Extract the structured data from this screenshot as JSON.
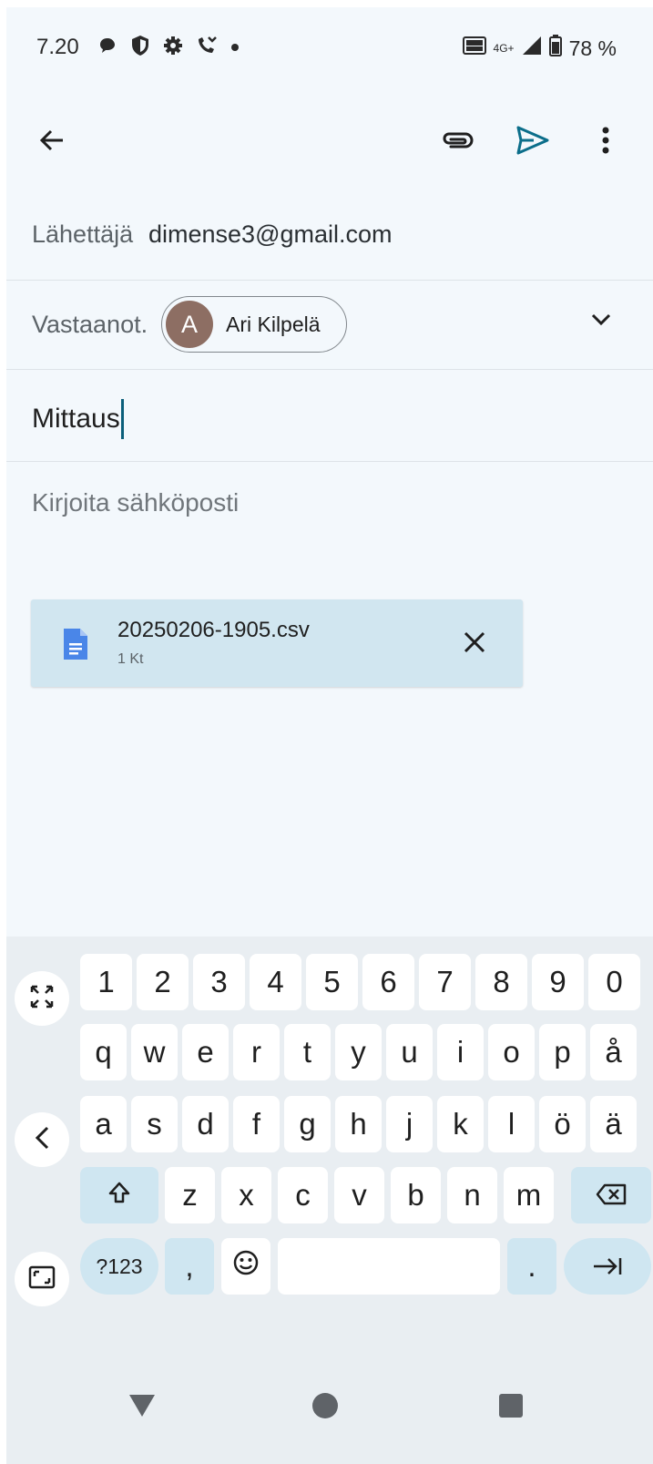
{
  "status_bar": {
    "time": "7.20",
    "battery": "78 %",
    "network": "4G+",
    "volte": "VO LTE",
    "icons": [
      "chat-bubble-icon",
      "shield-icon",
      "gear-icon",
      "missed-call-icon",
      "dot-icon",
      "volte-icon",
      "signal-icon",
      "battery-icon"
    ]
  },
  "app_bar": {
    "icons": [
      "back-arrow-icon",
      "attach-icon",
      "send-icon",
      "more-vert-icon"
    ],
    "accent": "#0b6e8a"
  },
  "compose": {
    "from_label": "Lähettäjä",
    "from_value": "dimense3@gmail.com",
    "to_label": "Vastaanot.",
    "recipient_initial": "A",
    "recipient_name": "Ari Kilpelä",
    "subject": "Mittaus",
    "body_placeholder": "Kirjoita sähköposti"
  },
  "attachment": {
    "file_name": "20250206-1905.csv",
    "file_size": "1 Kt"
  },
  "keyboard": {
    "row_numbers": [
      "1",
      "2",
      "3",
      "4",
      "5",
      "6",
      "7",
      "8",
      "9",
      "0"
    ],
    "row1": [
      "q",
      "w",
      "e",
      "r",
      "t",
      "y",
      "u",
      "i",
      "o",
      "p",
      "å"
    ],
    "row2": [
      "a",
      "s",
      "d",
      "f",
      "g",
      "h",
      "j",
      "k",
      "l",
      "ö",
      "ä"
    ],
    "row3": [
      "z",
      "x",
      "c",
      "v",
      "b",
      "n",
      "m"
    ],
    "symbols_label": "?123",
    "comma": ",",
    "period": "."
  }
}
